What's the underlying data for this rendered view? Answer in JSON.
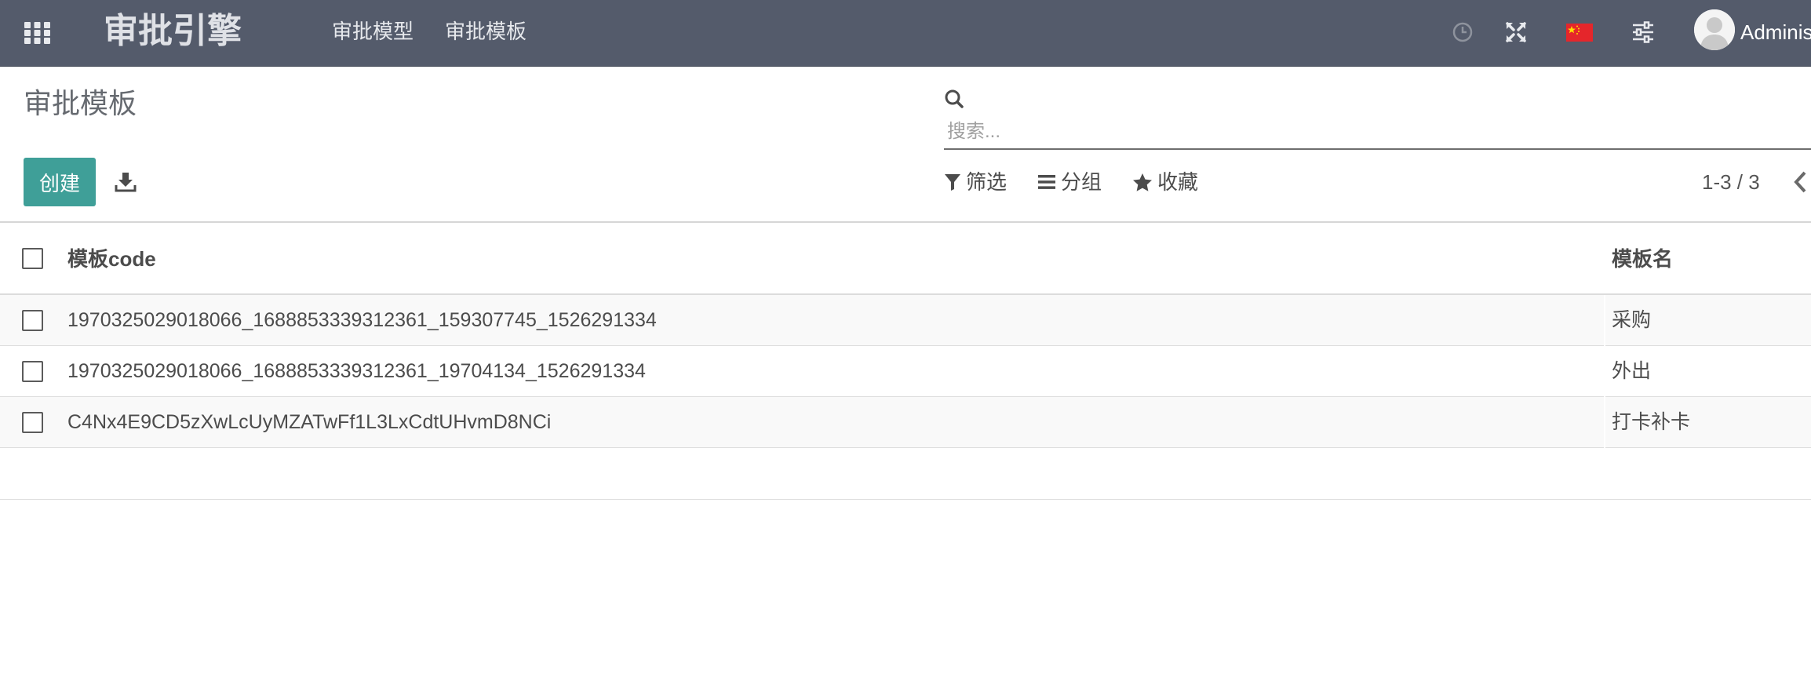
{
  "navbar": {
    "brand": "审批引擎",
    "menus": [
      "审批模型",
      "审批模板"
    ],
    "icons": [
      "clock-icon",
      "expand-icon",
      "china-flag-icon",
      "sliders-icon"
    ],
    "user_name": "Administrator",
    "colors": {
      "background": "#545b6b",
      "flag_red": "#e5262b",
      "flag_star": "#ffde00"
    }
  },
  "control_panel": {
    "title": "审批模板",
    "search": {
      "placeholder": "搜索...",
      "value": ""
    },
    "create_label": "创建",
    "filter_label": "筛选",
    "group_label": "分组",
    "favorites_label": "收藏",
    "pager": "1-3 / 3",
    "colors": {
      "primary_button": "#3f9f98"
    }
  },
  "list": {
    "headers": {
      "code": "模板code",
      "name": "模板名"
    },
    "rows": [
      {
        "code": "1970325029018066_1688853339312361_159307745_1526291334",
        "name": "采购"
      },
      {
        "code": "1970325029018066_1688853339312361_19704134_1526291334",
        "name": "外出"
      },
      {
        "code": "C4Nx4E9CD5zXwLcUyMZATwFf1L3LxCdtUHvmD8NCi",
        "name": "打卡补卡"
      }
    ]
  }
}
